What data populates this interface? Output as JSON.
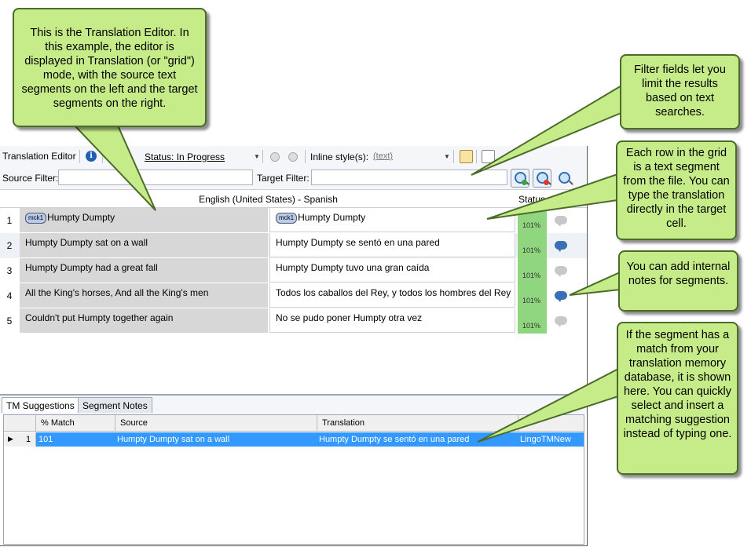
{
  "toolbar": {
    "title": "Translation Editor",
    "info_icon": "i",
    "status_label": "Status: In Progress",
    "inline_label": "Inline style(s):",
    "inline_value": "(text)"
  },
  "filters": {
    "source_label": "Source Filter:",
    "target_label": "Target Filter:"
  },
  "grid": {
    "language_pair": "English (United States) - Spanish",
    "status_header": "Status",
    "tag_label": "mck1",
    "rows": [
      {
        "num": "1",
        "source": "Humpty Dumpty",
        "target": "Humpty Dumpty",
        "status": "101%",
        "note": "gray"
      },
      {
        "num": "2",
        "source": "Humpty Dumpty sat on a wall",
        "target": "Humpty Dumpty se sentó en una pared",
        "status": "101%",
        "note": "blue"
      },
      {
        "num": "3",
        "source": "Humpty Dumpty had a great fall",
        "target": "Humpty Dumpty tuvo una gran caída",
        "status": "101%",
        "note": "gray"
      },
      {
        "num": "4",
        "source": "All the King's horses, And all the King's men",
        "target": "Todos los caballos del Rey, y todos los hombres del Rey",
        "status": "101%",
        "note": "blue"
      },
      {
        "num": "5",
        "source": "Couldn't put Humpty together again",
        "target": "No se pudo poner Humpty otra vez",
        "status": "101%",
        "note": "gray"
      }
    ]
  },
  "bottom_tabs": [
    "TM Suggestions",
    "Segment Notes"
  ],
  "tm": {
    "headers": [
      "% Match",
      "Source",
      "Translation"
    ],
    "rows": [
      {
        "num": "1",
        "match": "101",
        "source": "Humpty Dumpty sat on a wall",
        "translation": "Humpty Dumpty se sentó en una pared",
        "tm_name": "LingoTMNew"
      }
    ]
  },
  "callouts": {
    "editor": "This is the Translation Editor. In this example, the editor is displayed in Translation (or \"grid\") mode, with the source text segments on the left and the target segments on the right.",
    "filter": "Filter fields let you limit the results based on text searches.",
    "rows": "Each row in the grid is a text segment from the file. You can type the translation directly in the target cell.",
    "notes": "You can add internal notes for segments.",
    "tm": "If the segment has a match from your translation memory database, it is shown here. You can quickly select and insert a matching suggestion instead of typing one."
  },
  "colors": {
    "callout_fill": "#c6ec8a",
    "status_green": "#8fd67e",
    "selection_blue": "#3399ff",
    "note_blue": "#3a6fb5"
  }
}
